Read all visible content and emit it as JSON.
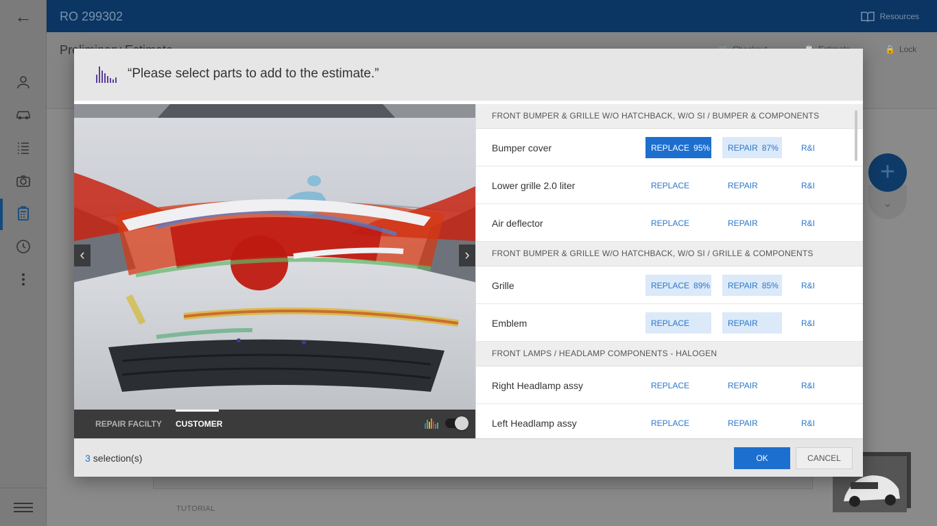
{
  "app": {
    "ro_title": "RO 299302",
    "resources_label": "Resources",
    "subheader_title": "Preliminary Estimate",
    "checkout_label": "Checkout",
    "estimate_label": "Estimate",
    "lock_label": "Lock",
    "tutorial_label": "TUTORIAL"
  },
  "modal": {
    "title": "“Please select parts to add to the estimate.”",
    "image_tabs": [
      {
        "label": "REPAIR FACILTY",
        "active": false
      },
      {
        "label": "CUSTOMER",
        "active": true
      }
    ],
    "heatmap_toggle_on": true,
    "sections": [
      {
        "title": "FRONT BUMPER & GRILLE W/O HATCHBACK, W/O SI / BUMPER & COMPONENTS",
        "parts": [
          {
            "name": "Bumper cover",
            "replace": "REPLACE",
            "replace_pct": "95%",
            "repair": "REPAIR",
            "repair_pct": "87%",
            "ri": "R&I"
          },
          {
            "name": "Lower grille 2.0 liter",
            "replace": "REPLACE",
            "repair": "REPAIR",
            "ri": "R&I"
          },
          {
            "name": "Air deflector",
            "replace": "REPLACE",
            "repair": "REPAIR",
            "ri": "R&I"
          }
        ]
      },
      {
        "title": "FRONT BUMPER & GRILLE W/O HATCHBACK, W/O SI / GRILLE & COMPONENTS",
        "parts": [
          {
            "name": "Grille",
            "replace": "REPLACE",
            "replace_pct": "89%",
            "repair": "REPAIR",
            "repair_pct": "85%",
            "ri": "R&I"
          },
          {
            "name": "Emblem",
            "replace": "REPLACE",
            "repair": "REPAIR",
            "ri": "R&I"
          }
        ]
      },
      {
        "title": "FRONT LAMPS / HEADLAMP COMPONENTS - HALOGEN",
        "parts": [
          {
            "name": "Right Headlamp assy",
            "replace": "REPLACE",
            "repair": "REPAIR",
            "ri": "R&I"
          },
          {
            "name": "Left Headlamp assy",
            "replace": "REPLACE",
            "repair": "REPAIR",
            "ri": "R&I"
          }
        ]
      }
    ],
    "footer": {
      "selection_count": "3",
      "selection_label": "selection(s)",
      "ok_label": "OK",
      "cancel_label": "CANCEL"
    }
  },
  "colors": {
    "primary": "#1c6fcf",
    "topbar": "#0b3562",
    "link": "#2a76c9"
  }
}
